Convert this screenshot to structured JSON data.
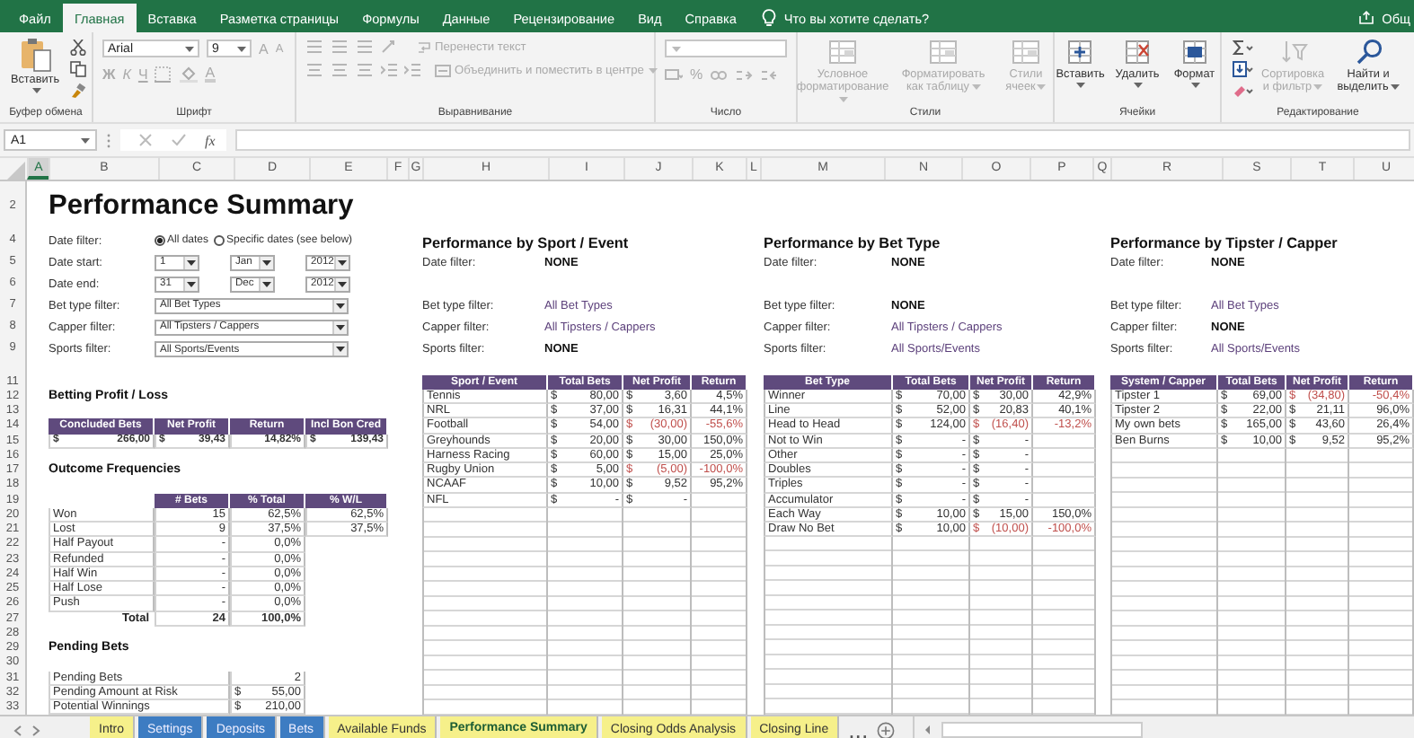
{
  "ribbon_tabs": [
    {
      "label": "Файл",
      "selected": false
    },
    {
      "label": "Главная",
      "selected": true
    },
    {
      "label": "Вставка",
      "selected": false
    },
    {
      "label": "Разметка страницы",
      "selected": false
    },
    {
      "label": "Формулы",
      "selected": false
    },
    {
      "label": "Данные",
      "selected": false
    },
    {
      "label": "Рецензирование",
      "selected": false
    },
    {
      "label": "Вид",
      "selected": false
    },
    {
      "label": "Справка",
      "selected": false
    }
  ],
  "tell_me": {
    "placeholder": "Что вы хотите сделать?"
  },
  "share": {
    "label": "Общ"
  },
  "ribbon": {
    "clipboard": {
      "label": "Буфер обмена",
      "paste": {
        "label": "Вставить"
      }
    },
    "font": {
      "label": "Шрифт",
      "family": "Arial",
      "size": "9",
      "grow": "A",
      "shrink": "A",
      "bold": "Ж",
      "italic": "К",
      "underline": "Ч",
      "color_letter": "A",
      "disabled": true
    },
    "alignment": {
      "label": "Выравнивание",
      "wrap": {
        "label": "Перенести текст"
      },
      "merge": {
        "label": "Объединить и поместить в центре"
      },
      "disabled": true
    },
    "number": {
      "label": "Число",
      "percent": "%",
      "disabled": true
    },
    "styles": {
      "label": "Стили",
      "buttons": [
        {
          "label": "Условное форматирование",
          "disabled": true
        },
        {
          "label": "Форматировать как таблицу",
          "disabled": true
        },
        {
          "label": "Стили ячеек",
          "disabled": true
        }
      ]
    },
    "cells": {
      "label": "Ячейки",
      "buttons": [
        {
          "label": "Вставить",
          "disabled": false
        },
        {
          "label": "Удалить",
          "disabled": false
        },
        {
          "label": "Формат",
          "disabled": false
        }
      ]
    },
    "editing": {
      "label": "Редактирование",
      "sort": {
        "label": "Сортировка и фильтр",
        "disabled": true
      },
      "find": {
        "label": "Найти и выделить",
        "disabled": false
      }
    }
  },
  "formula_bar": {
    "name_box": "A1",
    "function_label": "fx"
  },
  "column_headers": [
    {
      "label": "A",
      "selected": true
    },
    {
      "label": "B",
      "selected": false
    },
    {
      "label": "C",
      "selected": false
    },
    {
      "label": "D",
      "selected": false
    },
    {
      "label": "E",
      "selected": false
    },
    {
      "label": "F",
      "selected": false
    },
    {
      "label": "G",
      "selected": false
    },
    {
      "label": "H",
      "selected": false
    },
    {
      "label": "I",
      "selected": false
    },
    {
      "label": "J",
      "selected": false
    },
    {
      "label": "K",
      "selected": false
    },
    {
      "label": "L",
      "selected": false
    },
    {
      "label": "M",
      "selected": false
    },
    {
      "label": "N",
      "selected": false
    },
    {
      "label": "O",
      "selected": false
    },
    {
      "label": "P",
      "selected": false
    },
    {
      "label": "Q",
      "selected": false
    },
    {
      "label": "R",
      "selected": false
    },
    {
      "label": "S",
      "selected": false
    },
    {
      "label": "T",
      "selected": false
    },
    {
      "label": "U",
      "selected": false
    }
  ],
  "row_headers": [
    "2",
    "4",
    "5",
    "6",
    "7",
    "8",
    "9",
    "11",
    "12",
    "13",
    "14",
    "15",
    "16",
    "17",
    "18",
    "19",
    "20",
    "21",
    "22",
    "23",
    "24",
    "25",
    "26",
    "27",
    "28",
    "29",
    "30",
    "31",
    "32",
    "33"
  ],
  "summary": {
    "title": "Performance Summary",
    "filters": [
      {
        "label": "Date filter:",
        "kind": "radio",
        "options": [
          {
            "label": "All dates",
            "selected": true
          },
          {
            "label": "Specific dates (see below)",
            "selected": false
          }
        ]
      },
      {
        "label": "Date start:",
        "kind": "date",
        "parts": [
          "1",
          "Jan",
          "2012"
        ]
      },
      {
        "label": "Date end:",
        "kind": "date",
        "parts": [
          "31",
          "Dec",
          "2012"
        ]
      },
      {
        "label": "Bet type filter:",
        "kind": "combo",
        "value": "All Bet Types"
      },
      {
        "label": "Capper filter:",
        "kind": "combo",
        "value": "All Tipsters / Cappers"
      },
      {
        "label": "Sports filter:",
        "kind": "combo",
        "value": "All Sports/Events"
      }
    ],
    "profit_loss": {
      "title": "Betting Profit / Loss",
      "columns": [
        "Concluded Bets",
        "Net Profit",
        "Return",
        "Incl Bon Cred"
      ],
      "concluded": [
        "$",
        "266,00"
      ],
      "net_profit": [
        "$",
        "39,43"
      ],
      "return": "14,82%",
      "incl_bon_cred": [
        "$",
        "139,43"
      ]
    },
    "outcomes": {
      "title": "Outcome Frequencies",
      "columns": [
        "# Bets",
        "% Total",
        "% W/L"
      ],
      "rows": [
        {
          "label": "Won",
          "bets": "15",
          "total": "62,5%",
          "wl": "62,5%"
        },
        {
          "label": "Lost",
          "bets": "9",
          "total": "37,5%",
          "wl": "37,5%"
        },
        {
          "label": "Half Payout",
          "bets": "-",
          "total": "0,0%"
        },
        {
          "label": "Refunded",
          "bets": "-",
          "total": "0,0%"
        },
        {
          "label": "Half Win",
          "bets": "-",
          "total": "0,0%"
        },
        {
          "label": "Half Lose",
          "bets": "-",
          "total": "0,0%"
        },
        {
          "label": "Push",
          "bets": "-",
          "total": "0,0%"
        }
      ],
      "total": {
        "label": "Total",
        "bets": "24",
        "total": "100,0%"
      }
    },
    "pending": {
      "title": "Pending Bets",
      "rows": [
        {
          "label": "Pending Bets",
          "amount": "2"
        },
        {
          "label": "Pending Amount at Risk",
          "currency": "$",
          "amount": "55,00"
        },
        {
          "label": "Potential Winnings",
          "currency": "$",
          "amount": "210,00"
        }
      ]
    }
  },
  "breakdowns": [
    {
      "title": "Performance by Sport / Event",
      "filters": [
        {
          "label": "Date filter:",
          "value": "NONE",
          "bold": true
        },
        {
          "label": "Bet type filter:",
          "value": "All Bet Types",
          "bold": false
        },
        {
          "label": "Capper filter:",
          "value": "All Tipsters / Cappers",
          "bold": false
        },
        {
          "label": "Sports filter:",
          "value": "NONE",
          "bold": true
        }
      ],
      "columns": [
        "Sport / Event",
        "Total Bets",
        "Net Profit",
        "Return"
      ],
      "rows": [
        {
          "name": "Tennis",
          "total_bets": [
            "$",
            "80,00"
          ],
          "net_profit": [
            "$",
            "3,60"
          ],
          "return": "4,5%",
          "negative": false
        },
        {
          "name": "NRL",
          "total_bets": [
            "$",
            "37,00"
          ],
          "net_profit": [
            "$",
            "16,31"
          ],
          "return": "44,1%",
          "negative": false
        },
        {
          "name": "Football",
          "total_bets": [
            "$",
            "54,00"
          ],
          "net_profit": [
            "$",
            "(30,00)"
          ],
          "return": "-55,6%",
          "negative": true
        },
        {
          "name": "Greyhounds",
          "total_bets": [
            "$",
            "20,00"
          ],
          "net_profit": [
            "$",
            "30,00"
          ],
          "return": "150,0%",
          "negative": false
        },
        {
          "name": "Harness Racing",
          "total_bets": [
            "$",
            "60,00"
          ],
          "net_profit": [
            "$",
            "15,00"
          ],
          "return": "25,0%",
          "negative": false
        },
        {
          "name": "Rugby Union",
          "total_bets": [
            "$",
            "5,00"
          ],
          "net_profit": [
            "$",
            "(5,00)"
          ],
          "return": "-100,0%",
          "negative": true
        },
        {
          "name": "NCAAF",
          "total_bets": [
            "$",
            "10,00"
          ],
          "net_profit": [
            "$",
            "9,52"
          ],
          "return": "95,2%",
          "negative": false
        },
        {
          "name": "NFL",
          "total_bets": [
            "$",
            "-"
          ],
          "net_profit": [
            "$",
            "-"
          ],
          "negative": false
        }
      ]
    },
    {
      "title": "Performance by Bet Type",
      "filters": [
        {
          "label": "Date filter:",
          "value": "NONE",
          "bold": true
        },
        {
          "label": "Bet type filter:",
          "value": "NONE",
          "bold": true
        },
        {
          "label": "Capper filter:",
          "value": "All Tipsters / Cappers",
          "bold": false
        },
        {
          "label": "Sports filter:",
          "value": "All Sports/Events",
          "bold": false
        }
      ],
      "columns": [
        "Bet Type",
        "Total Bets",
        "Net Profit",
        "Return"
      ],
      "rows": [
        {
          "name": "Winner",
          "total_bets": [
            "$",
            "70,00"
          ],
          "net_profit": [
            "$",
            "30,00"
          ],
          "return": "42,9%",
          "negative": false
        },
        {
          "name": "Line",
          "total_bets": [
            "$",
            "52,00"
          ],
          "net_profit": [
            "$",
            "20,83"
          ],
          "return": "40,1%",
          "negative": false
        },
        {
          "name": "Head to Head",
          "total_bets": [
            "$",
            "124,00"
          ],
          "net_profit": [
            "$",
            "(16,40)"
          ],
          "return": "-13,2%",
          "negative": true
        },
        {
          "name": "Not to Win",
          "total_bets": [
            "$",
            "-"
          ],
          "net_profit": [
            "$",
            "-"
          ],
          "negative": false
        },
        {
          "name": "Other",
          "total_bets": [
            "$",
            "-"
          ],
          "net_profit": [
            "$",
            "-"
          ],
          "negative": false
        },
        {
          "name": "Doubles",
          "total_bets": [
            "$",
            "-"
          ],
          "net_profit": [
            "$",
            "-"
          ],
          "negative": false
        },
        {
          "name": "Triples",
          "total_bets": [
            "$",
            "-"
          ],
          "net_profit": [
            "$",
            "-"
          ],
          "negative": false
        },
        {
          "name": "Accumulator",
          "total_bets": [
            "$",
            "-"
          ],
          "net_profit": [
            "$",
            "-"
          ],
          "negative": false
        },
        {
          "name": "Each Way",
          "total_bets": [
            "$",
            "10,00"
          ],
          "net_profit": [
            "$",
            "15,00"
          ],
          "return": "150,0%",
          "negative": false
        },
        {
          "name": "Draw No Bet",
          "total_bets": [
            "$",
            "10,00"
          ],
          "net_profit": [
            "$",
            "(10,00)"
          ],
          "return": "-100,0%",
          "negative": true
        }
      ]
    },
    {
      "title": "Performance by Tipster / Capper",
      "filters": [
        {
          "label": "Date filter:",
          "value": "NONE",
          "bold": true
        },
        {
          "label": "Bet type filter:",
          "value": "All Bet Types",
          "bold": false
        },
        {
          "label": "Capper filter:",
          "value": "NONE",
          "bold": true
        },
        {
          "label": "Sports filter:",
          "value": "All Sports/Events",
          "bold": false
        }
      ],
      "columns": [
        "System / Capper",
        "Total Bets",
        "Net Profit",
        "Return"
      ],
      "rows": [
        {
          "name": "Tipster 1",
          "total_bets": [
            "$",
            "69,00"
          ],
          "net_profit": [
            "$",
            "(34,80)"
          ],
          "return": "-50,4%",
          "negative": true
        },
        {
          "name": "Tipster 2",
          "total_bets": [
            "$",
            "22,00"
          ],
          "net_profit": [
            "$",
            "21,11"
          ],
          "return": "96,0%",
          "negative": false
        },
        {
          "name": "My own bets",
          "total_bets": [
            "$",
            "165,00"
          ],
          "net_profit": [
            "$",
            "43,60"
          ],
          "return": "26,4%",
          "negative": false
        },
        {
          "name": "Ben Burns",
          "total_bets": [
            "$",
            "10,00"
          ],
          "net_profit": [
            "$",
            "9,52"
          ],
          "return": "95,2%",
          "negative": false
        }
      ]
    }
  ],
  "sheet_tabs": [
    {
      "label": "Intro",
      "color": "#f6f08a",
      "selected": false
    },
    {
      "label": "Settings",
      "color": "#3d7cc2",
      "selected": false
    },
    {
      "label": "Deposits",
      "color": "#3d7cc2",
      "selected": false
    },
    {
      "label": "Bets",
      "color": "#3d7cc2",
      "selected": false
    },
    {
      "label": "Available Funds",
      "color": "#f6f08a",
      "selected": false
    },
    {
      "label": "Performance Summary",
      "color": "#f6f08a",
      "selected": true
    },
    {
      "label": "Closing Odds Analysis",
      "color": "#f6f08a",
      "selected": false
    },
    {
      "label": "Closing Line",
      "color": "#f6f08a",
      "selected": false
    }
  ],
  "more_tabs": {
    "label": "..."
  }
}
